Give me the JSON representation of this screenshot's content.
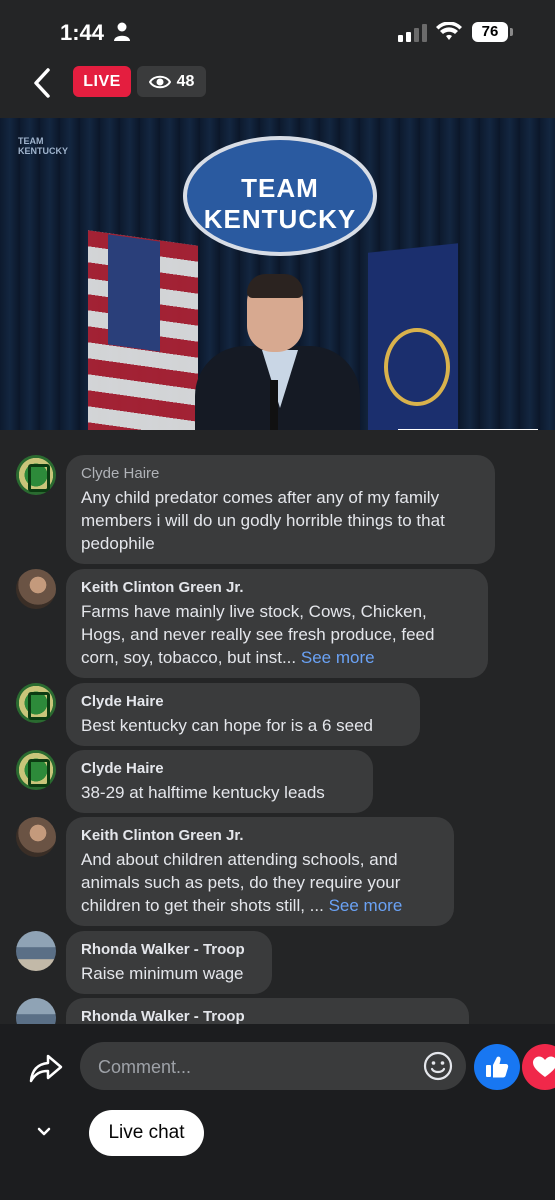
{
  "status_bar": {
    "time": "1:44",
    "battery": "76"
  },
  "header": {
    "live_label": "LIVE",
    "viewer_count": "48"
  },
  "video": {
    "watermark_line1": "TEAM",
    "watermark_line2": "KENTUCKY",
    "backdrop_text": "TEAM KENTUCKY"
  },
  "comments": [
    {
      "name": "Clyde Haire",
      "text": "Any child predator comes after any of my family members i will do un godly horrible things to that pedophile",
      "see_more": ""
    },
    {
      "name": "Keith Clinton Green Jr.",
      "text": "Farms have mainly live stock, Cows, Chicken, Hogs, and never really see fresh produce, feed corn, soy, tobacco, but inst...",
      "see_more": "See more"
    },
    {
      "name": "Clyde Haire",
      "text": "Best kentucky can hope for is a 6 seed",
      "see_more": ""
    },
    {
      "name": "Clyde Haire",
      "text": "38-29 at halftime kentucky leads",
      "see_more": ""
    },
    {
      "name": "Keith Clinton Green Jr.",
      "text": "And about children attending schools, and animals such as pets, do they require your children to get their shots still, ...",
      "see_more": "See more"
    },
    {
      "name": "Rhonda Walker - Troop",
      "text": "Raise minimum wage",
      "see_more": ""
    },
    {
      "name": "Rhonda Walker - Troop",
      "text": "",
      "see_more": ""
    }
  ],
  "composer": {
    "placeholder": "Comment..."
  },
  "footer": {
    "live_chat_label": "Live chat"
  },
  "colors": {
    "live_red": "#e41e3f",
    "like_blue": "#1877f2",
    "love_red": "#f0284a",
    "link_blue": "#6aa2f5"
  }
}
